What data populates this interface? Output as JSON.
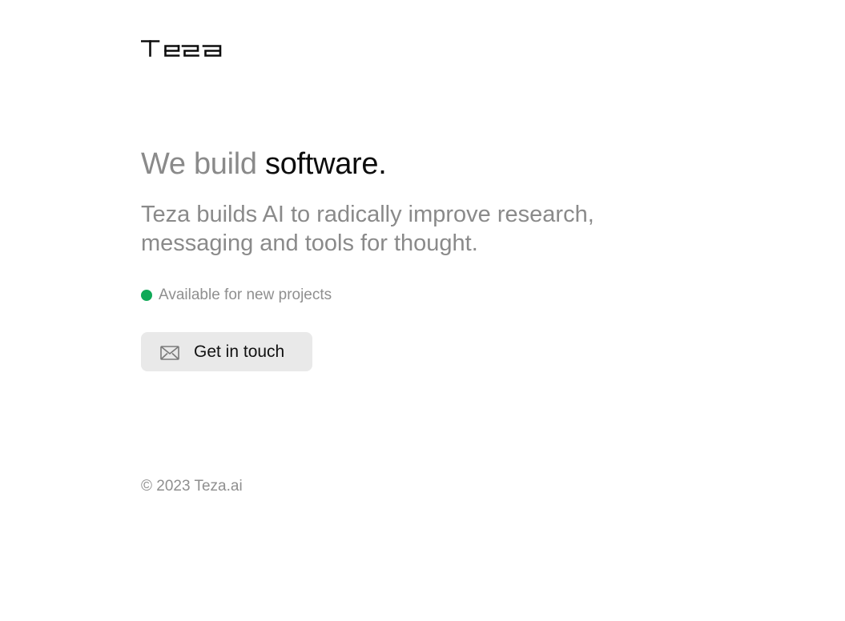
{
  "brand": {
    "logo_text": "TEZA",
    "logo_icon": "teza-wordmark"
  },
  "hero": {
    "headline_muted": "We build ",
    "headline_strong": "software.",
    "subheadline": "Teza builds AI to radically improve research, messaging and tools for thought."
  },
  "status": {
    "label": "Available for new projects",
    "color": "#0fa957"
  },
  "cta": {
    "label": "Get in touch",
    "icon": "mail-icon"
  },
  "footer": {
    "copyright": "© 2023 Teza.ai"
  }
}
